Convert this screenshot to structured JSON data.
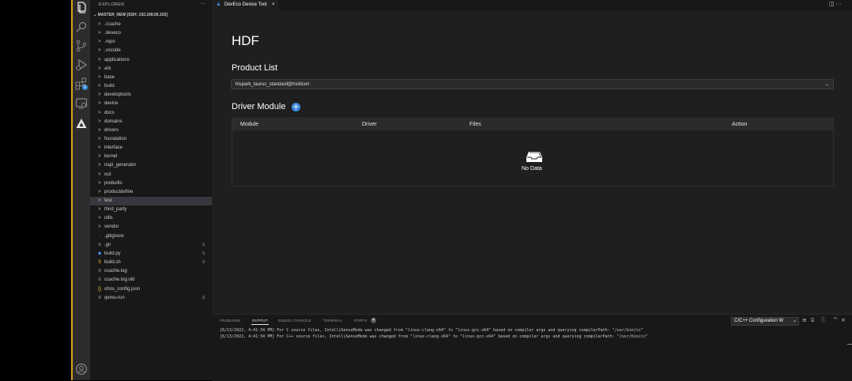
{
  "activity_bar": {
    "icons": [
      "explorer-icon",
      "search-icon",
      "source-control-icon",
      "run-debug-icon",
      "extensions-icon",
      "remote-explorer-icon",
      "deveco-icon",
      "account-icon"
    ],
    "extensions_badge": "1"
  },
  "sidebar": {
    "title": "EXPLORER",
    "more": "···",
    "root": "MASTER_NEW [SSH: 192.168.56.103]",
    "items": [
      {
        "label": ".ccache",
        "type": "folder"
      },
      {
        "label": ".deveco",
        "type": "folder"
      },
      {
        "label": ".repo",
        "type": "folder"
      },
      {
        "label": ".vscode",
        "type": "folder"
      },
      {
        "label": "applications",
        "type": "folder"
      },
      {
        "label": "ark",
        "type": "folder"
      },
      {
        "label": "base",
        "type": "folder"
      },
      {
        "label": "build",
        "type": "folder"
      },
      {
        "label": "developtools",
        "type": "folder"
      },
      {
        "label": "device",
        "type": "folder"
      },
      {
        "label": "docs",
        "type": "folder"
      },
      {
        "label": "domains",
        "type": "folder"
      },
      {
        "label": "drivers",
        "type": "folder"
      },
      {
        "label": "foundation",
        "type": "folder"
      },
      {
        "label": "interface",
        "type": "folder"
      },
      {
        "label": "kernel",
        "type": "folder"
      },
      {
        "label": "napi_generator",
        "type": "folder"
      },
      {
        "label": "out",
        "type": "folder"
      },
      {
        "label": "prebuilts",
        "type": "folder"
      },
      {
        "label": "productdefine",
        "type": "folder"
      },
      {
        "label": "test",
        "type": "folder",
        "selected": true
      },
      {
        "label": "third_party",
        "type": "folder"
      },
      {
        "label": "utils",
        "type": "folder"
      },
      {
        "label": "vendor",
        "type": "folder"
      },
      {
        "label": ".gitignore",
        "type": "file",
        "icon": "◦"
      },
      {
        "label": ".gn",
        "type": "file",
        "icon": "≡",
        "mod": "S"
      },
      {
        "label": "build.py",
        "type": "file",
        "icon": "◆",
        "mod": "S"
      },
      {
        "label": "build.sh",
        "type": "file",
        "icon": "$",
        "mod": "S"
      },
      {
        "label": "ccache.log",
        "type": "file",
        "icon": "≡"
      },
      {
        "label": "ccache.log.old",
        "type": "file",
        "icon": "≡"
      },
      {
        "label": "ohos_config.json",
        "type": "file",
        "icon": "{}"
      },
      {
        "label": "qemu-run",
        "type": "file",
        "icon": "≡",
        "mod": "S"
      }
    ]
  },
  "editor": {
    "tab_label": "DevEco Device Tool",
    "tab_close": "×",
    "title": "HDF",
    "product_list_label": "Product List",
    "product_selected": "hispark_taurus_standard@hisilicon",
    "driver_module_label": "Driver Module",
    "add_symbol": "+",
    "table": {
      "headers": [
        "Module",
        "Driver",
        "Files",
        "Action"
      ],
      "empty_text": "No Data"
    }
  },
  "panel": {
    "tabs": [
      "PROBLEMS",
      "OUTPUT",
      "DEBUG CONSOLE",
      "TERMINAL",
      "PORTS"
    ],
    "active_tab": "OUTPUT",
    "ports_badge": "4",
    "output_channel": "C/C++ Configuration W",
    "log_lines": [
      "[6/13/2022, 4:41:34 PM] For C source files, IntelliSenseMode was changed from \"linux-clang-x64\" to \"linux-gcc-x64\" based on compiler args and querying compilerPath: \"/usr/bin/cc\"",
      "[6/13/2022, 4:41:34 PM] For C++ source files, IntelliSenseMode was changed from \"linux-clang-x64\" to \"linux-gcc-x64\" based on compiler args and querying compilerPath: \"/usr/bin/cc\""
    ]
  },
  "colors": {
    "accent": "#3d8ee0",
    "window_edge": "#d7a21a",
    "background": "#1f1f1f",
    "sidebar": "#181818"
  }
}
